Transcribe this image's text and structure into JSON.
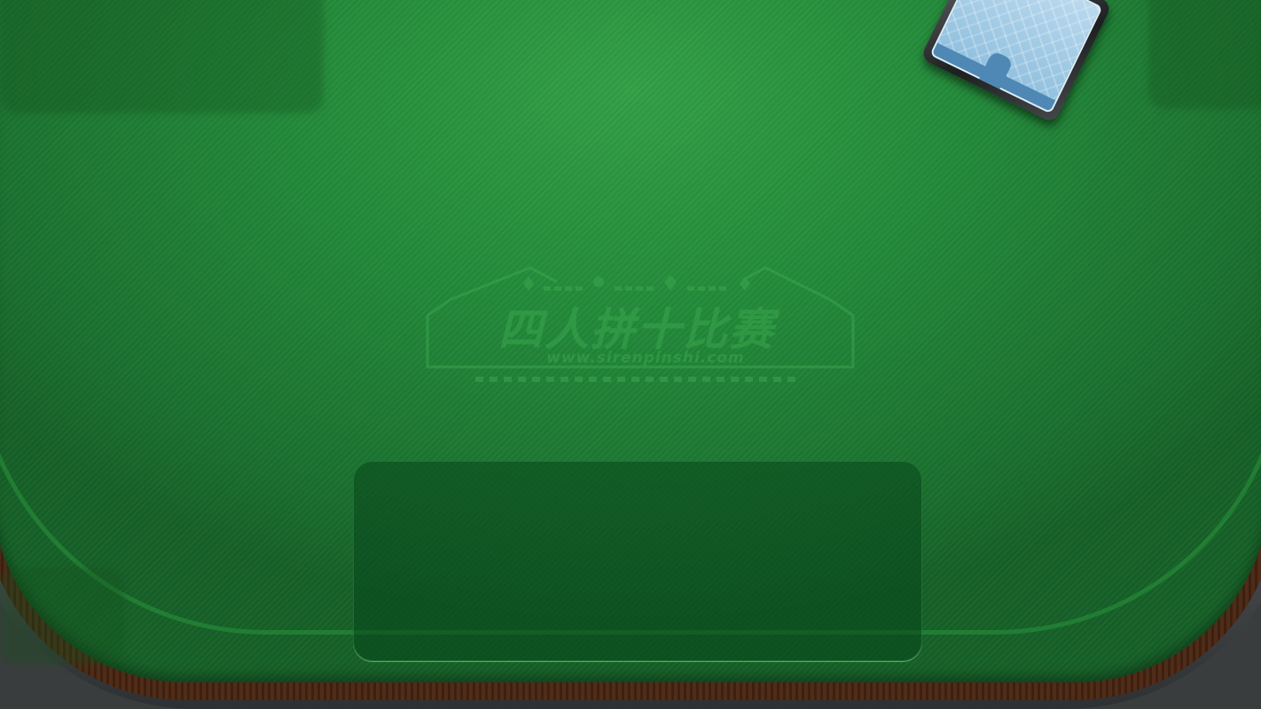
{
  "game": {
    "logo_title": "四人拼十比赛",
    "logo_url": "www.sirenpinshi.com"
  },
  "colors": {
    "felt": "#23893a",
    "felt_highlight": "#32a146",
    "wood_rim": "#4a2612",
    "rail": "#3a3d3e",
    "drop_zone": "#0e4f1e"
  },
  "icons": {
    "deck": "card-deck-icon"
  }
}
